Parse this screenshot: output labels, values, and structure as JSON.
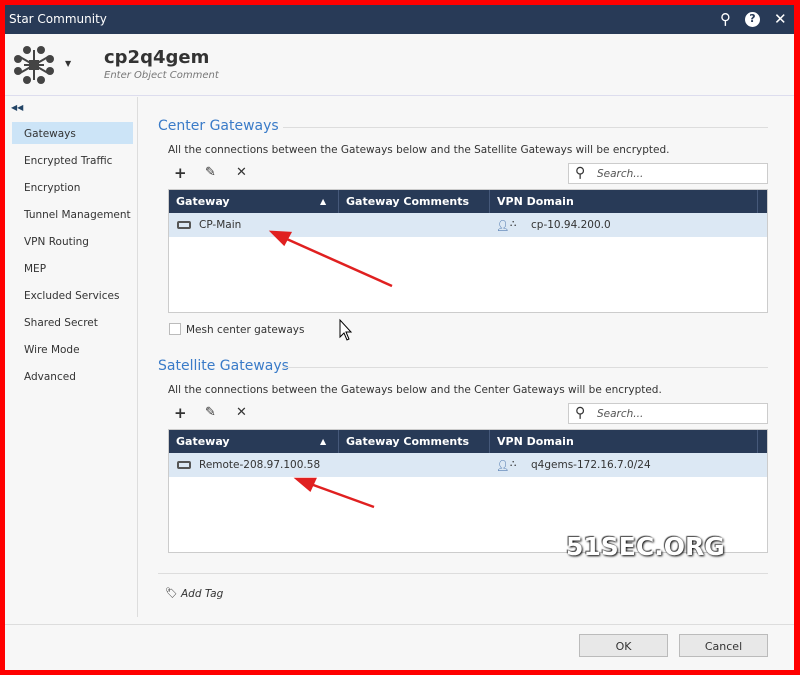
{
  "window": {
    "title": "Star Community"
  },
  "header": {
    "object_name": "cp2q4gem",
    "object_comment": "Enter Object Comment"
  },
  "sidebar": {
    "items": [
      {
        "label": "Gateways",
        "active": true
      },
      {
        "label": "Encrypted Traffic"
      },
      {
        "label": "Encryption"
      },
      {
        "label": "Tunnel Management"
      },
      {
        "label": "VPN Routing"
      },
      {
        "label": "MEP"
      },
      {
        "label": "Excluded Services"
      },
      {
        "label": "Shared Secret"
      },
      {
        "label": "Wire Mode"
      },
      {
        "label": "Advanced"
      }
    ]
  },
  "center": {
    "title": "Center Gateways",
    "description": "All the connections between the Gateways below and the Satellite Gateways will be encrypted.",
    "search_placeholder": "Search...",
    "columns": [
      "Gateway",
      "Gateway Comments",
      "VPN Domain"
    ],
    "rows": [
      {
        "gateway": "CP-Main",
        "comments": "",
        "vpn_domain": "cp-10.94.200.0"
      }
    ],
    "mesh_label": "Mesh center gateways",
    "mesh_checked": false
  },
  "satellite": {
    "title": "Satellite Gateways",
    "description": "All the connections between the Gateways below and the Center Gateways will be encrypted.",
    "search_placeholder": "Search...",
    "columns": [
      "Gateway",
      "Gateway Comments",
      "VPN Domain"
    ],
    "rows": [
      {
        "gateway": "Remote-208.97.100.58",
        "comments": "",
        "vpn_domain": "q4gems-172.16.7.0/24"
      }
    ]
  },
  "add_tag": "Add Tag",
  "buttons": {
    "ok": "OK",
    "cancel": "Cancel"
  },
  "watermark": "51SEC.ORG",
  "colors": {
    "titlebar": "#283a57",
    "accent": "#3a7bc8",
    "selected_row": "#dce8f4",
    "annotation": "#e02020"
  }
}
